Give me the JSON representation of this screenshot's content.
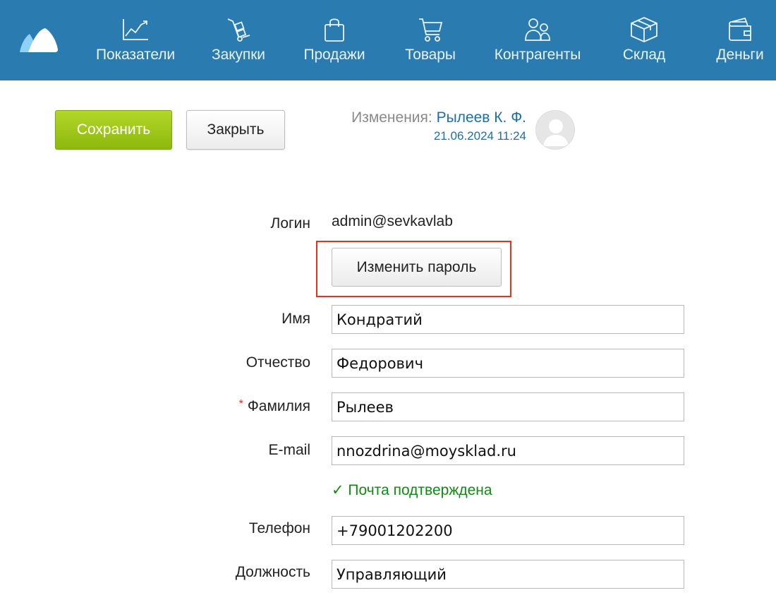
{
  "nav": {
    "items": [
      {
        "label": "Показатели",
        "icon": "chart-icon"
      },
      {
        "label": "Закупки",
        "icon": "hand-truck-icon"
      },
      {
        "label": "Продажи",
        "icon": "shopping-bag-icon"
      },
      {
        "label": "Товары",
        "icon": "cart-icon"
      },
      {
        "label": "Контрагенты",
        "icon": "people-icon"
      },
      {
        "label": "Склад",
        "icon": "box-icon"
      },
      {
        "label": "Деньги",
        "icon": "wallet-icon"
      }
    ]
  },
  "toolbar": {
    "save_label": "Сохранить",
    "close_label": "Закрыть"
  },
  "changes": {
    "label": "Изменения:",
    "author": "Рылеев К. Ф.",
    "date": "21.06.2024 11:24"
  },
  "form": {
    "login_label": "Логин",
    "login_value": "admin@sevkavlab",
    "change_password_label": "Изменить пароль",
    "first_name_label": "Имя",
    "first_name_value": "Кондратий",
    "patronymic_label": "Отчество",
    "patronymic_value": "Федорович",
    "required_mark": "*",
    "last_name_label": "Фамилия",
    "last_name_value": "Рылеев",
    "email_label": "E-mail",
    "email_value": "nnozdrina@moysklad.ru",
    "email_verified": "✓ Почта подтверждена",
    "phone_label": "Телефон",
    "phone_value": "+79001202200",
    "position_label": "Должность",
    "position_value": "Управляющий"
  },
  "colors": {
    "topbar": "#2a7bb0",
    "save_button": "#9cc51a",
    "link": "#1e6ea7",
    "verified": "#138a13",
    "highlight": "#e2331f"
  }
}
